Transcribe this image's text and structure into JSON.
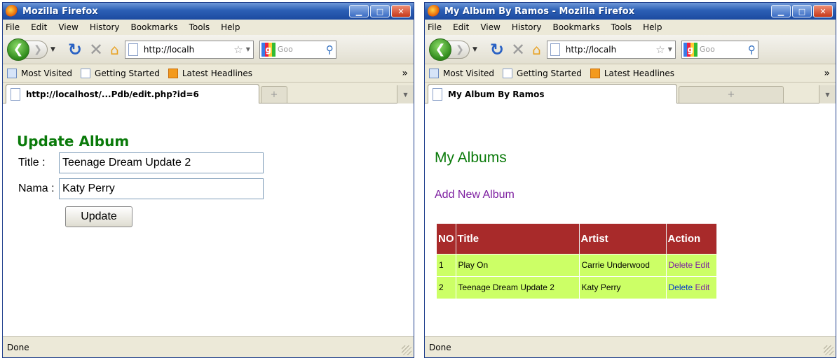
{
  "menu": [
    "File",
    "Edit",
    "View",
    "History",
    "Bookmarks",
    "Tools",
    "Help"
  ],
  "bookmarks": {
    "most_visited": "Most Visited",
    "getting_started": "Getting Started",
    "latest_headlines": "Latest Headlines",
    "more": "»"
  },
  "url": "http://localh",
  "search_placeholder": "Goo",
  "status": "Done",
  "left": {
    "window_title": "Mozilla Firefox",
    "tab_title": "http://localhost/...Pdb/edit.php?id=6",
    "heading": "Update Album",
    "title_label": "Title  :",
    "title_value": "Teenage Dream Update 2",
    "nama_label": "Nama :",
    "nama_value": "Katy Perry",
    "update_button": "Update"
  },
  "right": {
    "window_title": "My Album By Ramos - Mozilla Firefox",
    "tab_title": "My Album By Ramos",
    "heading": "My Albums",
    "add_link": "Add New Album",
    "columns": [
      "NO",
      "Title",
      "Artist",
      "Action"
    ],
    "rows": [
      {
        "no": "1",
        "title": "Play On",
        "artist": "Carrie Underwood",
        "delete": "Delete",
        "edit": "Edit"
      },
      {
        "no": "2",
        "title": "Teenage Dream Update 2",
        "artist": "Katy Perry",
        "delete": "Delete",
        "edit": "Edit"
      }
    ]
  }
}
